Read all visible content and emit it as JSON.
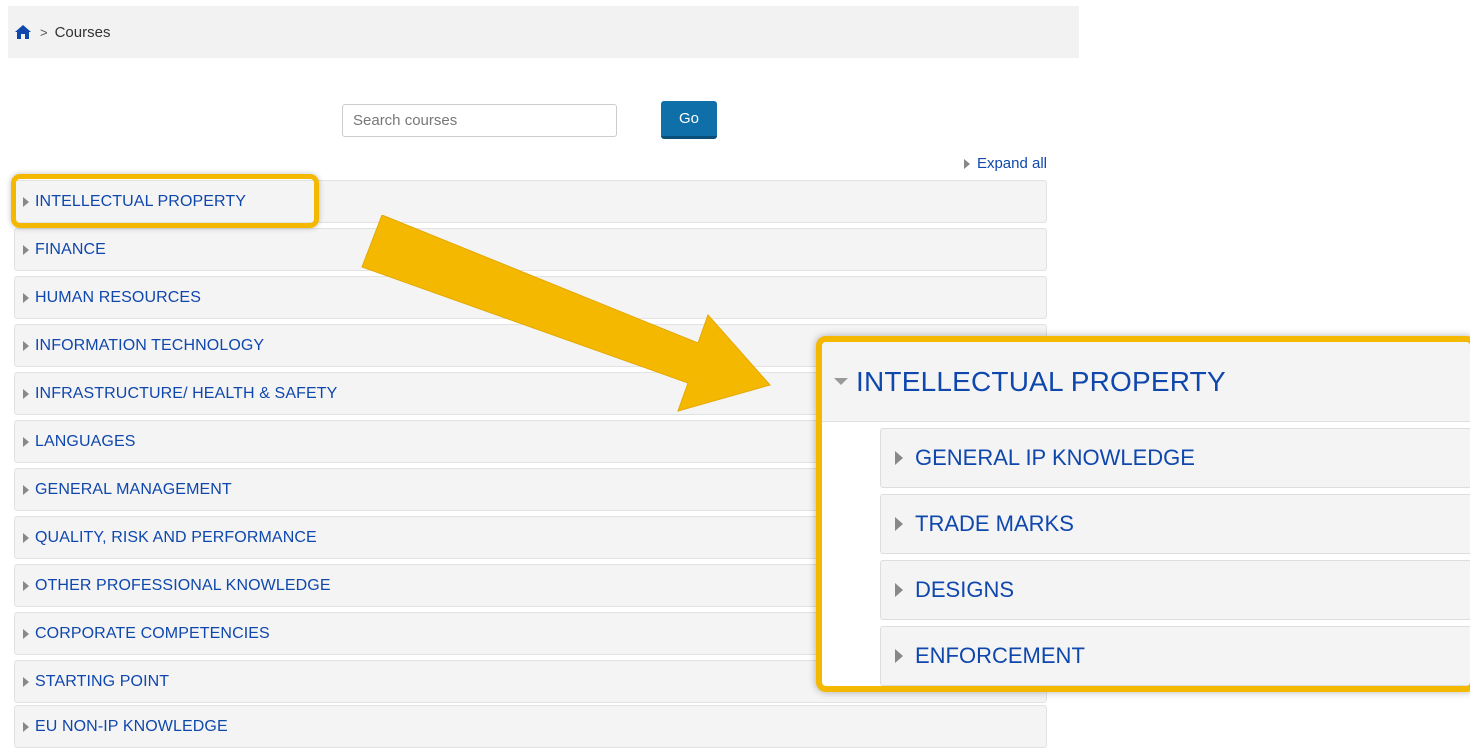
{
  "breadcrumb": {
    "home_icon": "home-icon",
    "separator": ">",
    "current": "Courses"
  },
  "search": {
    "placeholder": "Search courses",
    "value": "",
    "go_label": "Go"
  },
  "expand_all_label": "Expand all",
  "categories": [
    "INTELLECTUAL PROPERTY",
    "FINANCE",
    "HUMAN RESOURCES",
    "INFORMATION TECHNOLOGY",
    "INFRASTRUCTURE/ HEALTH & SAFETY",
    "LANGUAGES",
    "GENERAL MANAGEMENT",
    "QUALITY, RISK AND PERFORMANCE",
    "OTHER PROFESSIONAL KNOWLEDGE",
    "CORPORATE COMPETENCIES",
    "STARTING POINT",
    "EU NON-IP KNOWLEDGE"
  ],
  "zoom": {
    "header": "INTELLECTUAL PROPERTY",
    "subcategories": [
      "GENERAL IP KNOWLEDGE",
      "TRADE MARKS",
      "DESIGNS",
      "ENFORCEMENT"
    ]
  },
  "colors": {
    "highlight": "#f5b800",
    "link": "#0f47ad",
    "go_button": "#0f6fa8",
    "home_icon": "#0f47ad"
  }
}
